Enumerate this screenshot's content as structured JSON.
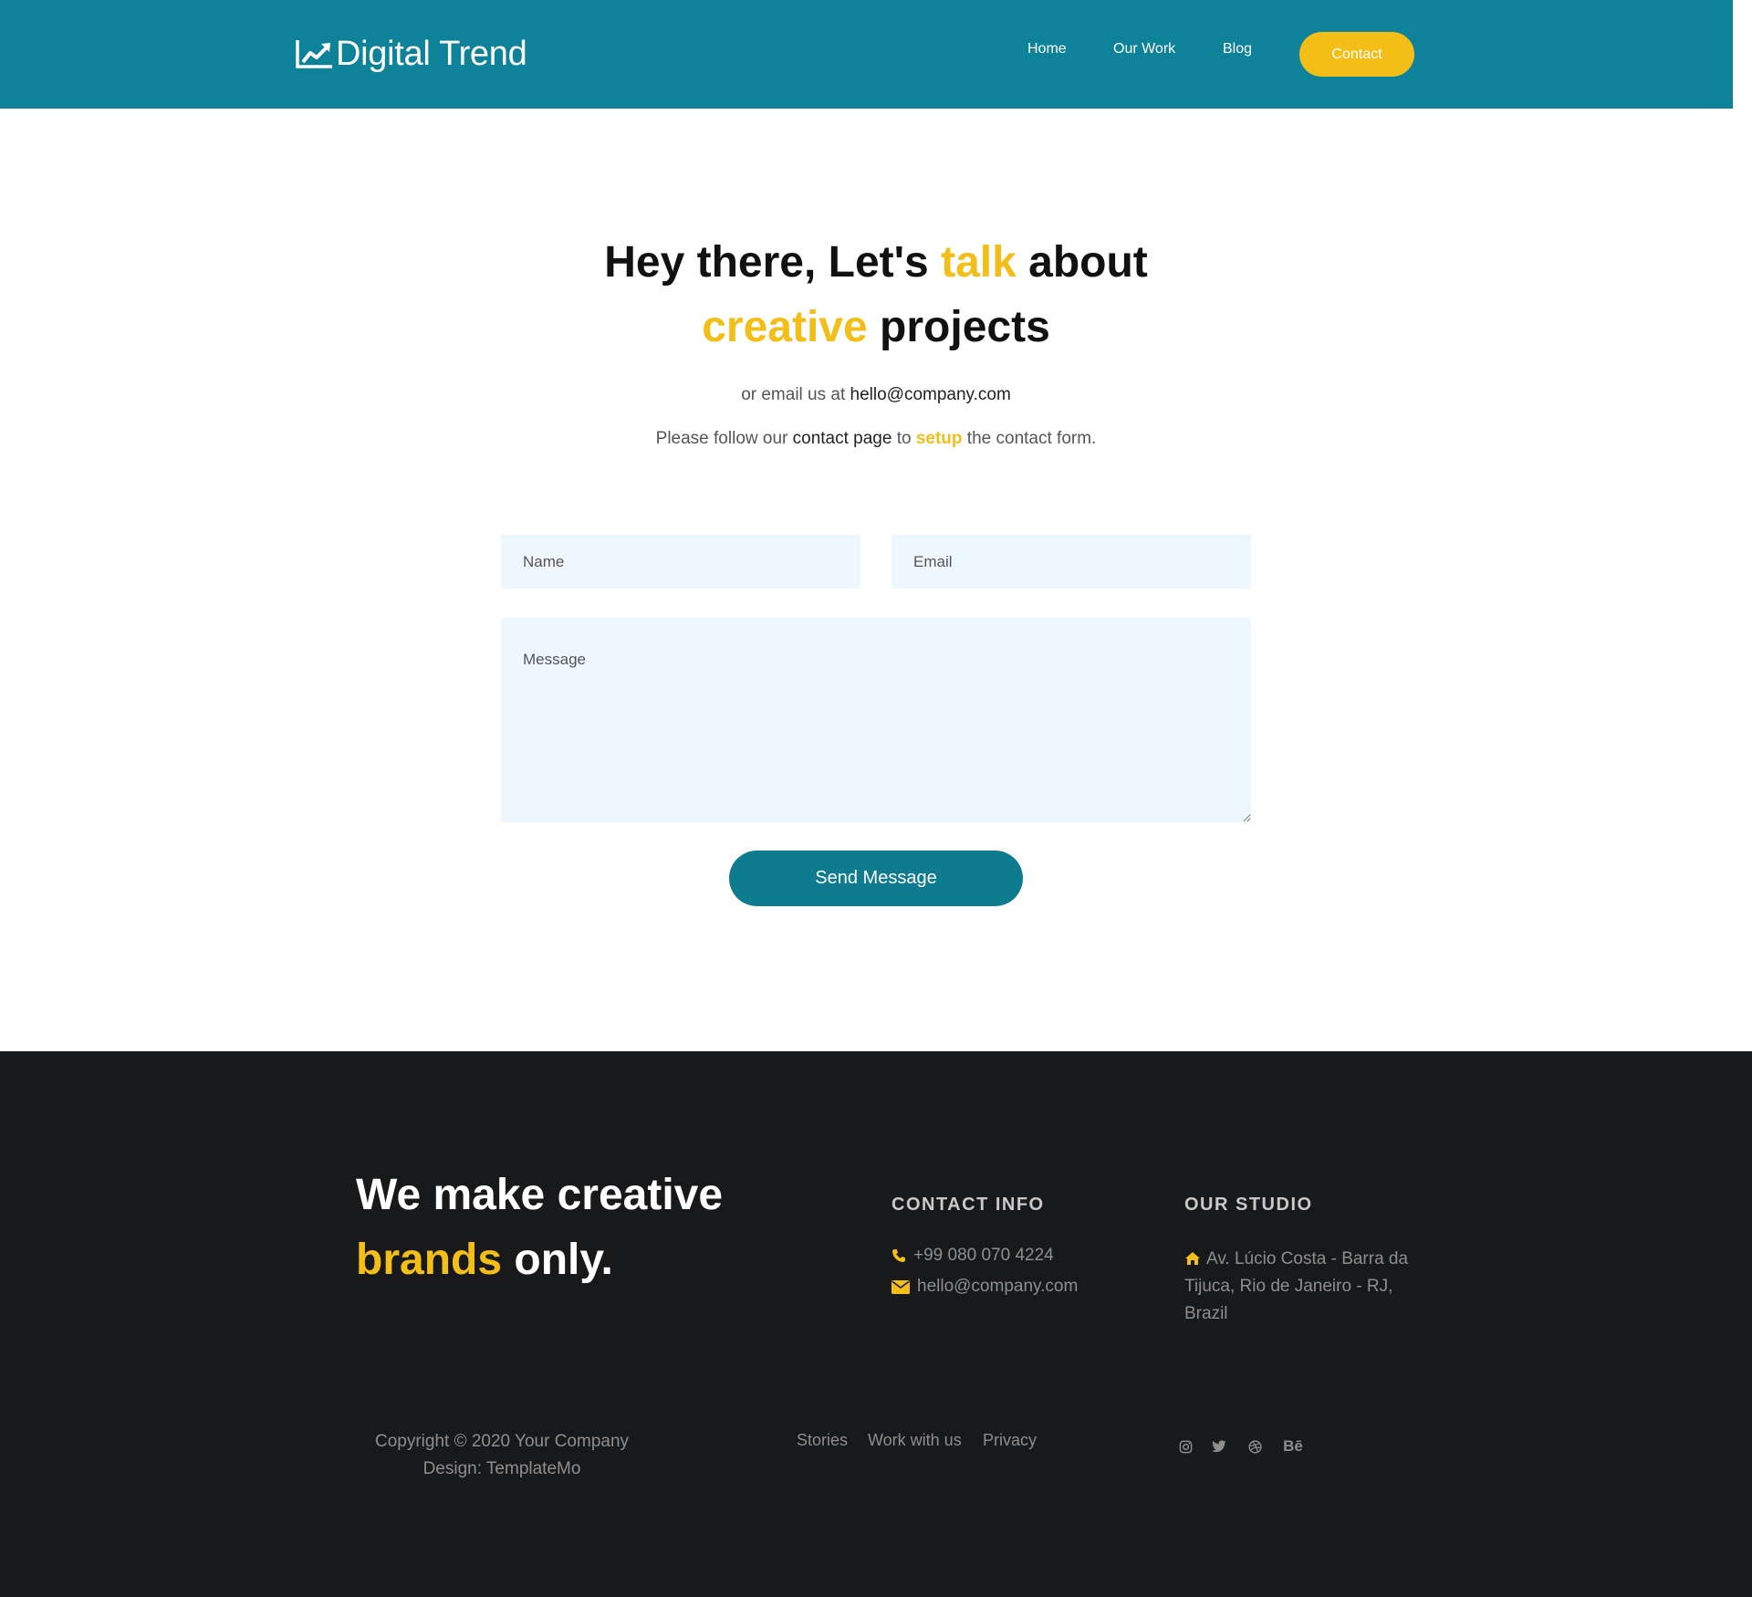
{
  "nav": {
    "brand": "Digital Trend",
    "links": [
      "Home",
      "Our Work",
      "Blog"
    ],
    "cta": "Contact"
  },
  "hero": {
    "title_1": "Hey there, Let's ",
    "title_hl_1": "talk",
    "title_2": " about",
    "title_hl_2": "creative",
    "title_3": " projects",
    "line1_prefix": "or email us at ",
    "line1_email": "hello@company.com",
    "line2_prefix": "Please follow our ",
    "line2_link": "contact page",
    "line2_mid": " to ",
    "line2_hl": "setup",
    "line2_suffix": " the contact form."
  },
  "form": {
    "name_placeholder": "Name",
    "email_placeholder": "Email",
    "message_placeholder": "Message",
    "submit": "Send Message"
  },
  "footer": {
    "tagline_1": "We make creative",
    "tagline_hl": "brands",
    "tagline_2": " only.",
    "contact_heading": "CONTACT INFO",
    "phone": "+99 080 070 4224",
    "email": "hello@company.com",
    "studio_heading": "OUR STUDIO",
    "address": "Av. Lúcio Costa - Barra da Tijuca, Rio de Janeiro - RJ, Brazil",
    "copyright": "Copyright © 2020 Your Company",
    "design": "Design: TemplateMo",
    "links": [
      "Stories",
      "Work with us",
      "Privacy"
    ],
    "social": {
      "icons": [
        "instagram-icon",
        "twitter-icon",
        "dribbble-icon",
        "behance-icon"
      ],
      "behance_label": "Bē"
    }
  },
  "colors": {
    "primary": "#0e8298",
    "accent": "#f2be17",
    "footer_bg": "#18191b",
    "field_bg": "#eef6fe"
  }
}
